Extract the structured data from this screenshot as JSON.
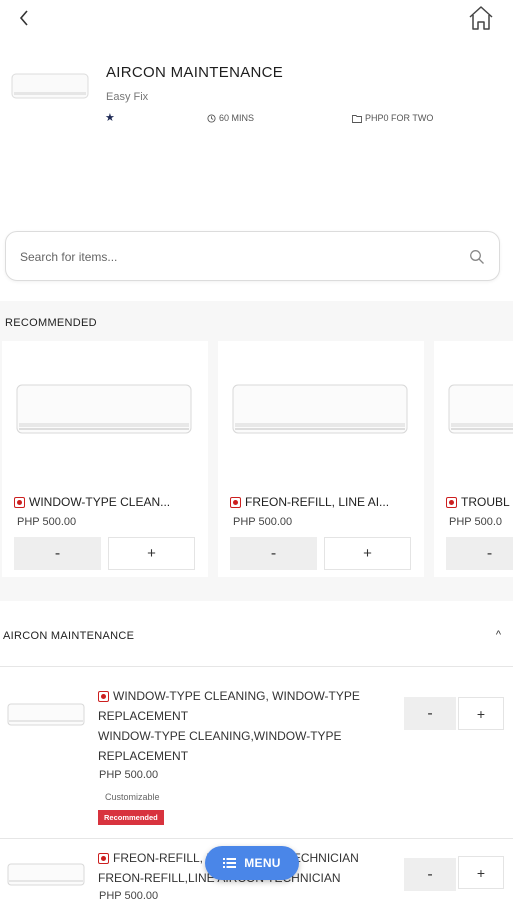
{
  "store": {
    "title": "AIRCON MAINTENANCE",
    "subtitle": "Easy Fix",
    "rating_symbol": "★",
    "time": "60 MINS",
    "cost": "PHP0 FOR TWO"
  },
  "search": {
    "placeholder": "Search for items..."
  },
  "recommended": {
    "title": "RECOMMENDED",
    "items": [
      {
        "name": "WINDOW-TYPE CLEAN...",
        "price": "PHP 500.00",
        "minus": "-",
        "plus": "+"
      },
      {
        "name": "FREON-REFILL, LINE AI...",
        "price": "PHP 500.00",
        "minus": "-",
        "plus": "+"
      },
      {
        "name": "TROUBL",
        "price": "PHP 500.0",
        "minus": "-",
        "plus": "+"
      }
    ]
  },
  "category": {
    "title": "AIRCON MAINTENANCE",
    "chevron": "^",
    "items": [
      {
        "name_lines": [
          "WINDOW-TYPE CLEANING, WINDOW-TYPE",
          "REPLACEMENT"
        ],
        "desc_lines": [
          "WINDOW-TYPE CLEANING,WINDOW-TYPE",
          "REPLACEMENT"
        ],
        "price": "PHP 500.00",
        "customizable": "Customizable",
        "badge": "Recommended",
        "minus": "-",
        "plus": "+"
      },
      {
        "name_lines": [
          "FREON-REFILL, LINE AIRCON TECHNICIAN"
        ],
        "desc_lines": [
          "FREON-REFILL,LINE AIRCON TECHNICIAN"
        ],
        "price": "PHP 500.00",
        "minus": "-",
        "plus": "+"
      }
    ]
  },
  "fab": {
    "label": "MENU"
  },
  "colors": {
    "accent": "#4a86e8",
    "badge": "#d8333e",
    "veg_marker": "#cc1f1f",
    "star": "#1f2a55"
  }
}
